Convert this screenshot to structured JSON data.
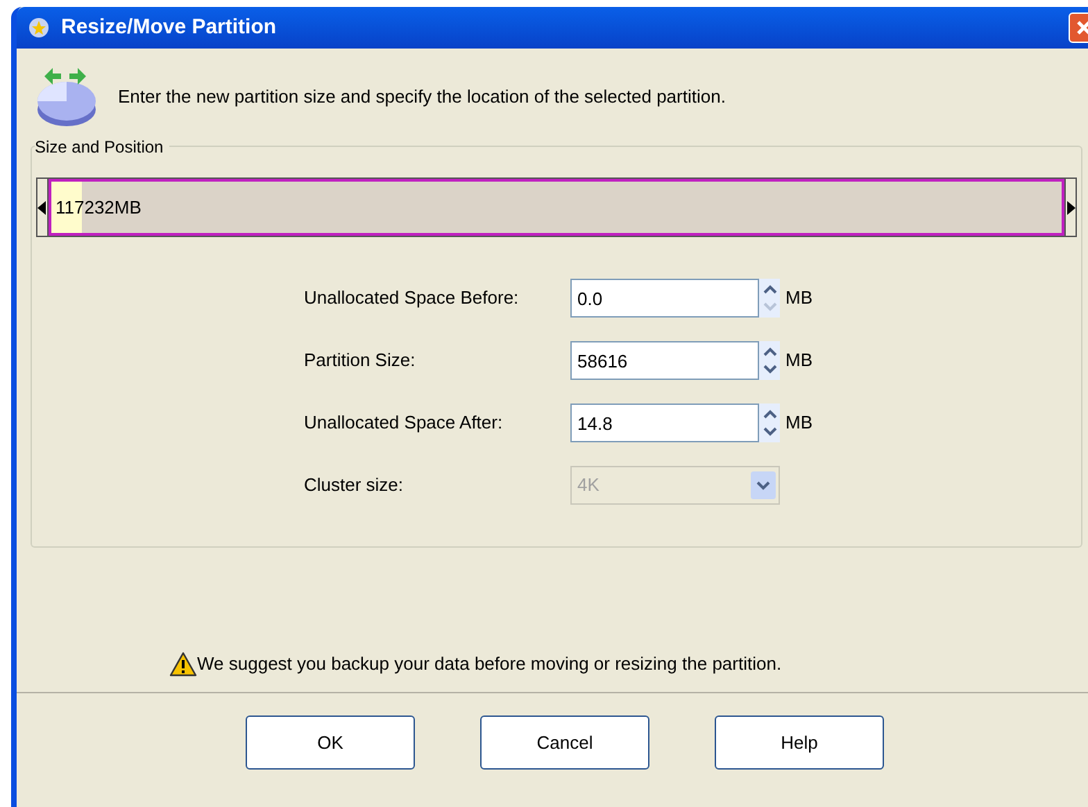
{
  "window": {
    "title": "Resize/Move Partition"
  },
  "description": "Enter the new partition size and specify the location of the selected partition.",
  "group": {
    "title": "Size and Position",
    "partition_bar": {
      "label": "117232MB",
      "level": 0.03
    },
    "fields": [
      {
        "kind": "spin",
        "label": "Unallocated Space Before:",
        "value": "0.0",
        "unit": "MB",
        "down_disabled": true
      },
      {
        "kind": "spin",
        "label": "Partition Size:",
        "value": "58616",
        "unit": "MB",
        "down_disabled": false
      },
      {
        "kind": "spin",
        "label": "Unallocated Space After:",
        "value": "14.8",
        "unit": "MB",
        "down_disabled": false
      },
      {
        "kind": "select",
        "label": "Cluster size:",
        "value": "4K",
        "disabled": true
      }
    ]
  },
  "warning": "We suggest you backup your data before moving or resizing the partition.",
  "buttons": [
    "OK",
    "Cancel",
    "Help"
  ]
}
